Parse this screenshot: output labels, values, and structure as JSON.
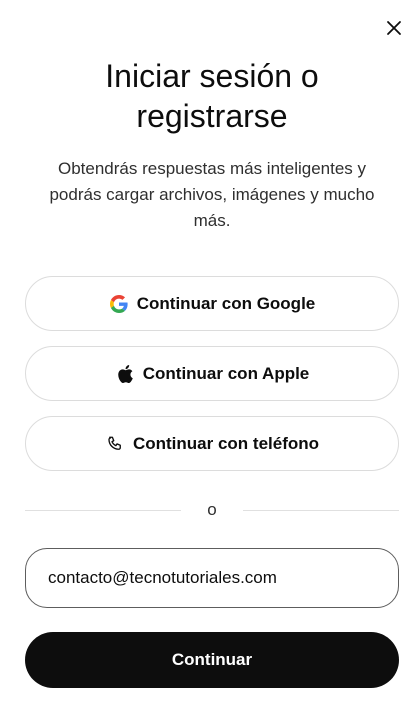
{
  "modal": {
    "title": "Iniciar sesión o registrarse",
    "subtitle": "Obtendrás respuestas más inteligentes y podrás cargar archivos, imágenes y mucho más.",
    "close_icon": "close-icon"
  },
  "auth": {
    "google_label": "Continuar con Google",
    "google_icon": "google-icon",
    "apple_label": "Continuar con Apple",
    "apple_icon": "apple-icon",
    "phone_label": "Continuar con teléfono",
    "phone_icon": "phone-icon"
  },
  "divider": {
    "label": "o"
  },
  "email": {
    "value": "contacto@tecnotutoriales.com"
  },
  "submit": {
    "label": "Continuar"
  },
  "colors": {
    "primary_button": "#0d0d0d",
    "border": "#dcdcdc",
    "google_blue": "#4285F4",
    "google_red": "#EA4335",
    "google_yellow": "#FBBC05",
    "google_green": "#34A853"
  }
}
